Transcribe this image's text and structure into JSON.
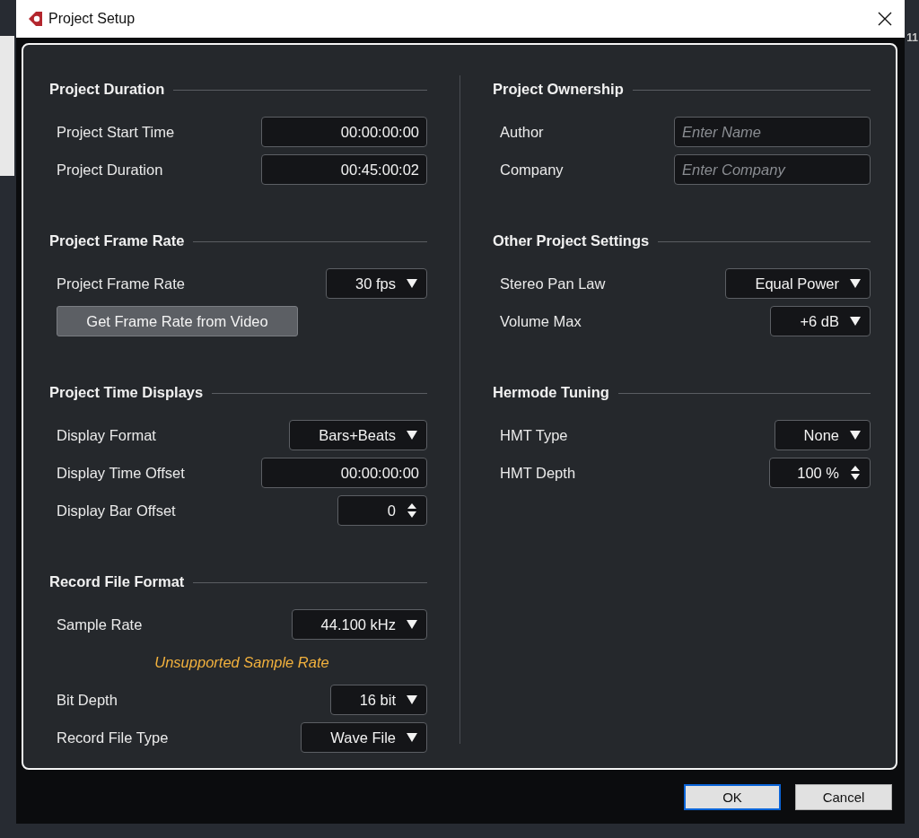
{
  "window": {
    "title": "Project Setup"
  },
  "background": {
    "ruler_label": "11"
  },
  "columns": [
    {
      "sections": [
        {
          "title": "Project Duration",
          "rows": [
            {
              "kind": "field",
              "label": "Project Start Time",
              "value": "00:00:00:00"
            },
            {
              "kind": "field",
              "label": "Project Duration",
              "value": "00:45:00:02"
            }
          ]
        },
        {
          "title": "Project Frame Rate",
          "rows": [
            {
              "kind": "select",
              "label": "Project Frame Rate",
              "value": "30 fps"
            },
            {
              "kind": "action",
              "text": "Get Frame Rate from Video"
            }
          ]
        },
        {
          "title": "Project Time Displays",
          "rows": [
            {
              "kind": "select",
              "label": "Display Format",
              "value": "Bars+Beats"
            },
            {
              "kind": "field",
              "label": "Display Time Offset",
              "value": "00:00:00:00"
            },
            {
              "kind": "spin",
              "label": "Display Bar Offset",
              "value": "0"
            }
          ]
        },
        {
          "title": "Record File Format",
          "rows": [
            {
              "kind": "select",
              "label": "Sample Rate",
              "value": "44.100 kHz"
            },
            {
              "kind": "note",
              "text": "Unsupported Sample Rate"
            },
            {
              "kind": "select",
              "label": "Bit Depth",
              "value": "16 bit"
            },
            {
              "kind": "select",
              "label": "Record File Type",
              "value": "Wave File"
            }
          ]
        }
      ]
    },
    {
      "sections": [
        {
          "title": "Project Ownership",
          "rows": [
            {
              "kind": "input",
              "label": "Author",
              "placeholder": "Enter Name"
            },
            {
              "kind": "input",
              "label": "Company",
              "placeholder": "Enter Company"
            }
          ]
        },
        {
          "title": "Other Project Settings",
          "rows": [
            {
              "kind": "select",
              "label": "Stereo Pan Law",
              "value": "Equal Power"
            },
            {
              "kind": "select",
              "label": "Volume Max",
              "value": "+6 dB"
            }
          ]
        },
        {
          "title": "Hermode Tuning",
          "rows": [
            {
              "kind": "select",
              "label": "HMT Type",
              "value": "None"
            },
            {
              "kind": "spin",
              "label": "HMT Depth",
              "value": "100 %"
            }
          ]
        }
      ]
    }
  ],
  "buttons": [
    {
      "label": "OK",
      "default": true
    },
    {
      "label": "Cancel",
      "default": false
    }
  ]
}
